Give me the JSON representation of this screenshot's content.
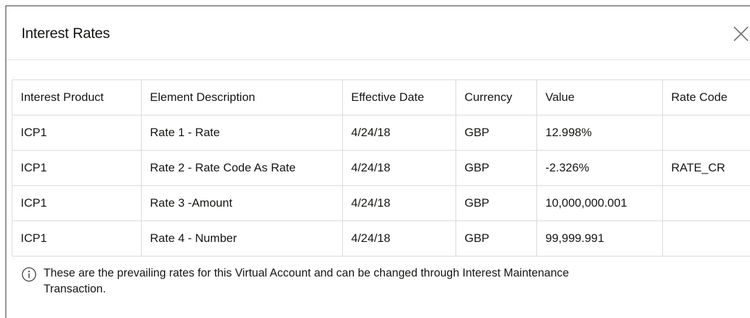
{
  "dialog": {
    "title": "Interest Rates"
  },
  "table": {
    "columns": [
      "Interest Product",
      "Element Description",
      "Effective Date",
      "Currency",
      "Value",
      "Rate Code"
    ],
    "rows": [
      [
        "ICP1",
        "Rate 1 - Rate",
        "4/24/18",
        "GBP",
        "12.998%",
        ""
      ],
      [
        "ICP1",
        "Rate 2 - Rate Code As Rate",
        "4/24/18",
        "GBP",
        "-2.326%",
        "RATE_CR"
      ],
      [
        "ICP1",
        "Rate 3 -Amount",
        "4/24/18",
        "GBP",
        "10,000,000.001",
        ""
      ],
      [
        "ICP1",
        "Rate 4 - Number",
        "4/24/18",
        "GBP",
        "99,999.991",
        ""
      ]
    ]
  },
  "info": {
    "line1": "These are the prevailing rates for this Virtual Account and can be changed through Interest Maintenance",
    "line2": "Transaction.",
    "icon": "info-icon"
  },
  "icons": {
    "close": "close-icon"
  },
  "colors": {
    "border": "#dcdad6",
    "text": "#161513",
    "frame": "#3c3c3c"
  }
}
